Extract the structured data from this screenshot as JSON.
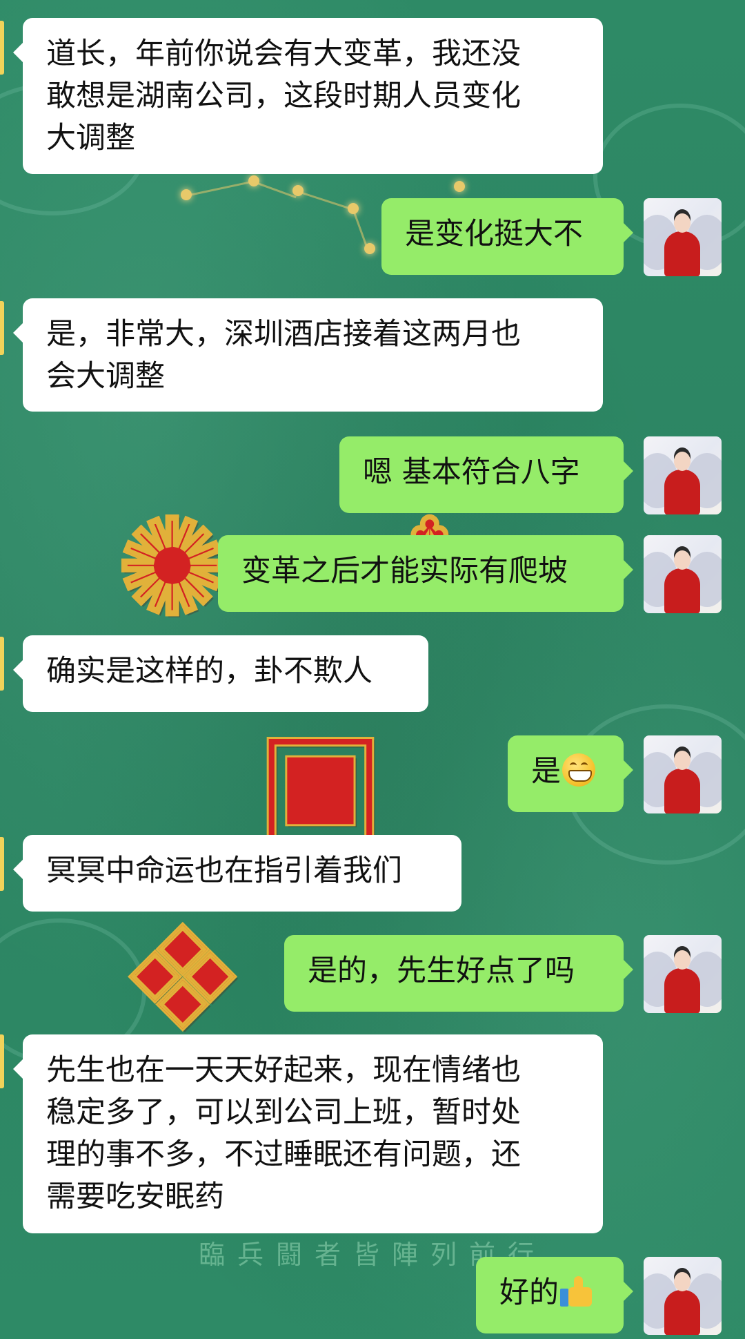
{
  "colors": {
    "background": "#2e8a66",
    "bubble_other": "#ffffff",
    "bubble_me": "#95ec69",
    "text": "#111111",
    "glyph_red": "#d32222"
  },
  "background": {
    "motto": "臨兵闘者皆陣列前行"
  },
  "messages": [
    {
      "sender": "other",
      "lines": [
        "道长，年前你说会有大变革，我还没",
        "敢想是湖南公司，这段时期人员变化",
        "大调整"
      ]
    },
    {
      "sender": "me",
      "text": "是变化挺大不"
    },
    {
      "sender": "other",
      "lines": [
        "是，非常大，深圳酒店接着这两月也",
        "会大调整"
      ]
    },
    {
      "sender": "me",
      "text": "嗯 基本符合八字"
    },
    {
      "sender": "me",
      "text": "变革之后才能实际有爬坡"
    },
    {
      "sender": "other",
      "lines": [
        "确实是这样的，卦不欺人"
      ]
    },
    {
      "sender": "me",
      "text": "是",
      "emoji": "grinning-face-emoji"
    },
    {
      "sender": "other",
      "lines": [
        "冥冥中命运也在指引着我们"
      ]
    },
    {
      "sender": "me",
      "text": "是的，先生好点了吗"
    },
    {
      "sender": "other",
      "lines": [
        "先生也在一天天好起来，现在情绪也",
        "稳定多了，可以到公司上班，暂时处",
        "理的事不多，不过睡眠还有问题，还",
        "需要吃安眠药"
      ]
    },
    {
      "sender": "me",
      "text": "好的",
      "emoji": "thumbs-up-emoji"
    }
  ]
}
